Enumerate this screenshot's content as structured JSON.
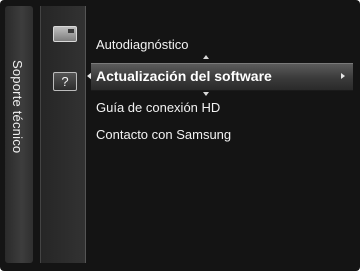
{
  "menu": {
    "title": "Soporte técnico",
    "icons": [
      "picture-icon",
      "help-icon"
    ],
    "support_icon_glyph": "?",
    "items": [
      {
        "label": "Autodiagnóstico",
        "selected": false
      },
      {
        "label": "Actualización del software",
        "selected": true
      },
      {
        "label": "Guía de conexión HD",
        "selected": false
      },
      {
        "label": "Contacto con Samsung",
        "selected": false
      }
    ]
  }
}
